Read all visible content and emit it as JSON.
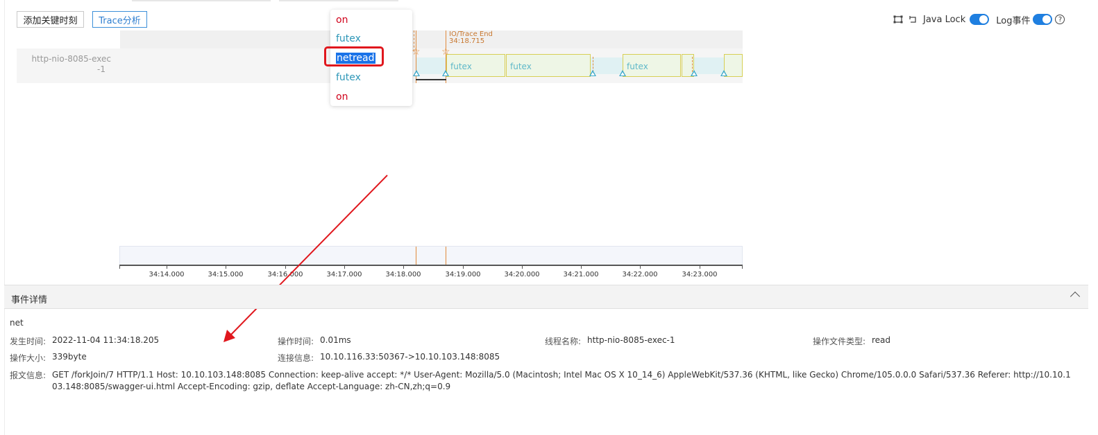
{
  "toolbar": {
    "add_key_moment": "添加关键时刻",
    "trace_analysis": "Trace分析",
    "java_lock": "Java Lock",
    "log_event": "Log事件",
    "help": "?"
  },
  "timeline": {
    "thread_label_line1": "http-nio-8085-exec",
    "thread_label_line2": "-1",
    "io_trace_end_label": "IO/Trace End",
    "io_trace_end_time": "34:18.715",
    "segments": [
      "futex",
      "futex",
      "futex"
    ]
  },
  "popup_menu": {
    "items": [
      "on",
      "futex",
      "netread",
      "futex",
      "on"
    ],
    "selected": "netread"
  },
  "axis": {
    "ticks": [
      "34:14.000",
      "34:15.000",
      "34:16.000",
      "34:17.000",
      "34:18.000",
      "34:19.000",
      "34:20.000",
      "34:21.000",
      "34:22.000",
      "34:23.000"
    ]
  },
  "details": {
    "section_title": "事件详情",
    "event_name": "net",
    "occurred_time_label": "发生时间:",
    "occurred_time": "2022-11-04 11:34:18.205",
    "op_duration_label": "操作时间:",
    "op_duration": "0.01ms",
    "thread_name_label": "线程名称:",
    "thread_name": "http-nio-8085-exec-1",
    "file_type_label": "操作文件类型:",
    "file_type": "read",
    "op_size_label": "操作大小:",
    "op_size": "339byte",
    "connection_label": "连接信息:",
    "connection": "10.10.116.33:50367->10.10.103.148:8085",
    "message_label": "报文信息:",
    "message": "GET /forkJoin/7 HTTP/1.1 Host: 10.10.103.148:8085 Connection: keep-alive accept: */* User-Agent: Mozilla/5.0 (Macintosh; Intel Mac OS X 10_14_6) AppleWebKit/537.36 (KHTML, like Gecko) Chrome/105.0.0.0 Safari/537.36 Referer: http://10.10.103.148:8085/swagger-ui.html Accept-Encoding: gzip, deflate Accept-Language: zh-CN,zh;q=0.9"
  },
  "colors": {
    "accent_blue": "#1f7fe0",
    "marker_orange": "#e08a3c",
    "annotation_red": "#e0171d"
  }
}
